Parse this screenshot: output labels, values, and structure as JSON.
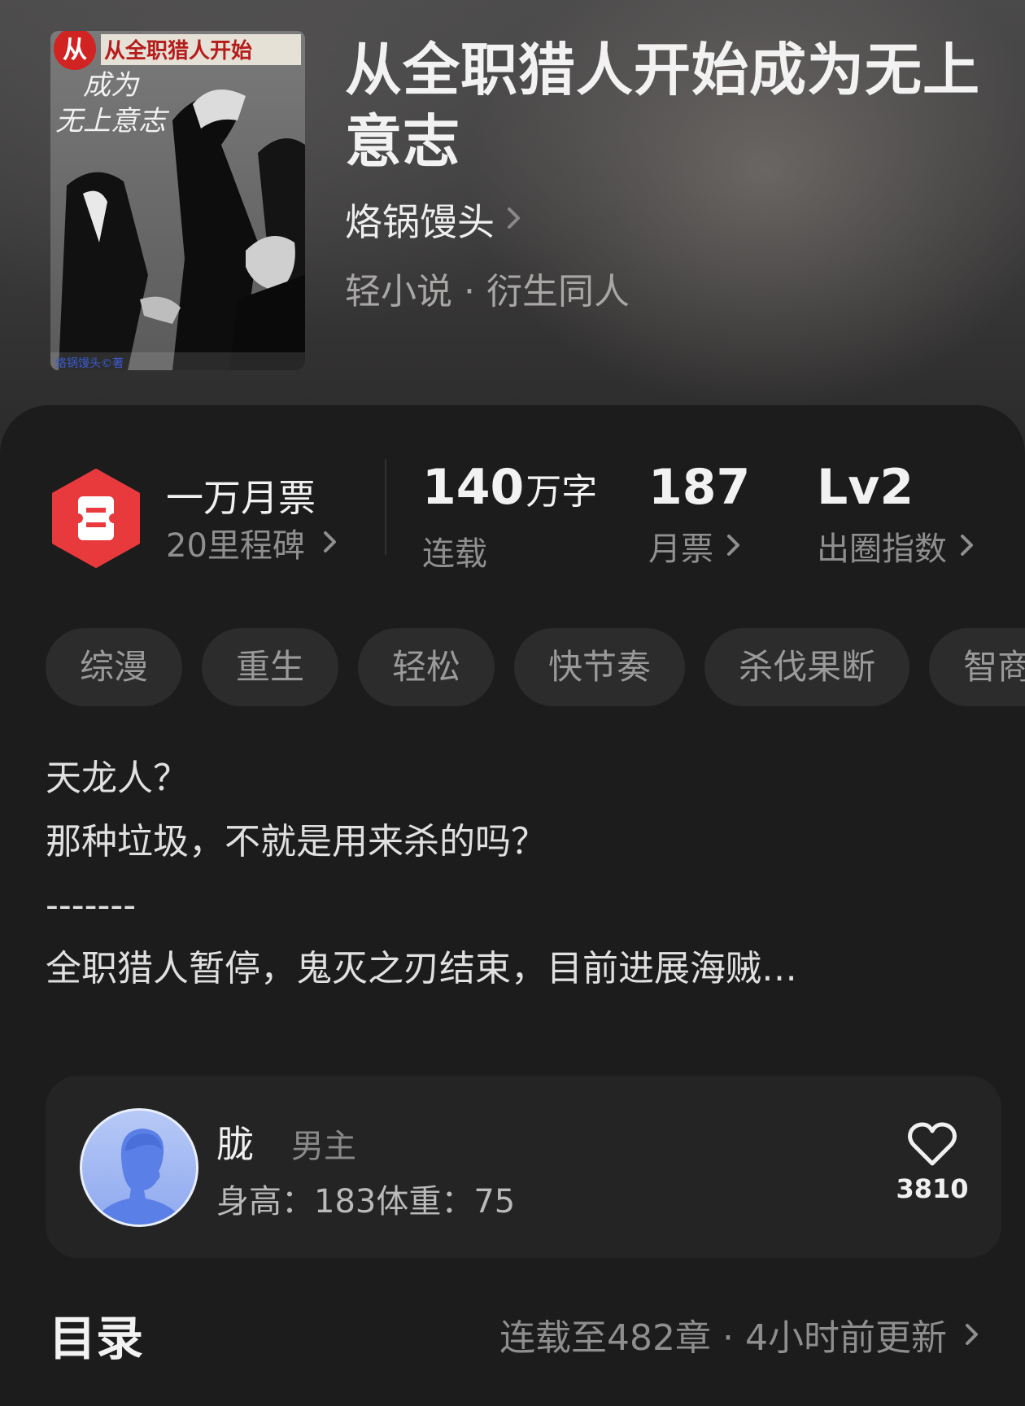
{
  "book": {
    "title": "从全职猎人开始成为无上意志",
    "author": "烙锅馒头",
    "genre": "轻小说 · 衍生同人",
    "cover": {
      "title_top": "从全职猎人开始",
      "title_line2": "成为",
      "title_line3": "无上意志",
      "credit": "烙锅馒头©著"
    }
  },
  "honor": {
    "title": "一万月票",
    "subtitle": "20里程碑"
  },
  "stats": {
    "words_value": "140",
    "words_unit": "万字",
    "words_label": "连载",
    "monthly_votes_value": "187",
    "monthly_votes_label": "月票",
    "index_value": "Lv2",
    "index_label": "出圈指数"
  },
  "tags": [
    "综漫",
    "重生",
    "轻松",
    "快节奏",
    "杀伐果断",
    "智商在线"
  ],
  "synopsis": {
    "lines": [
      "天龙人？",
      "那种垃圾，不就是用来杀的吗？",
      "-------",
      "全职猎人暂停，鬼灭之刃结束，目前进展海贼…"
    ]
  },
  "character": {
    "name": "胧",
    "role": "男主",
    "info": "身高：183体重：75",
    "likes": "3810"
  },
  "toc": {
    "title": "目录",
    "status": "连载至482章 · 4小时前更新"
  },
  "colors": {
    "badge_red": "#e8393d",
    "background": "#1c1c1d",
    "tag_bg": "#2c2c2d"
  }
}
